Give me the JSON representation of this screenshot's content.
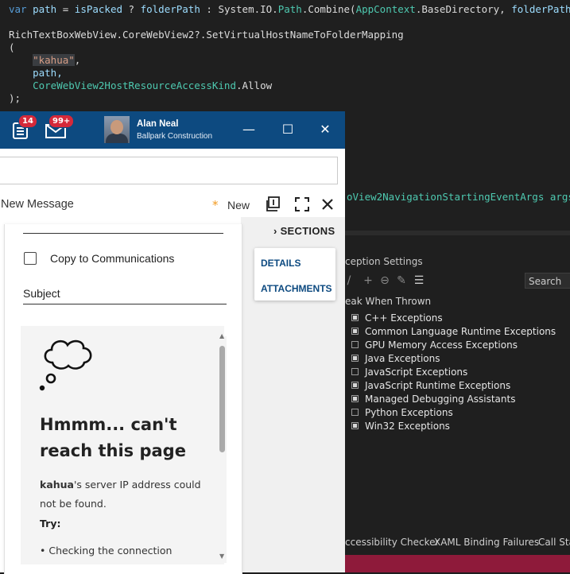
{
  "editor": {
    "line1": {
      "kw": "var",
      "id1": "path",
      "eq": " = ",
      "id2": "isPacked",
      "q": " ? ",
      "id3": "folderPath",
      "c": " : ",
      "ns": "System.IO.",
      "ty": "Path",
      "dot": ".",
      "m": "Combine(",
      "ty2": "AppContext",
      "m2": ".BaseDirectory, ",
      "id4": "folderPath",
      "end": ");"
    },
    "line3": "RichTextBoxWebView.CoreWebView2?.SetVirtualHostNameToFolderMapping",
    "line4": "(",
    "line5_str": "\"kahua\"",
    "line5_end": ",",
    "line6": "path,",
    "line7_ty": "CoreWebView2HostResourceAccessKind",
    "line7_end": ".Allow",
    "line8": ");",
    "fragment": "oView2NavigationStartingEventArgs args)"
  },
  "exceptions": {
    "title": "ception Settings",
    "search": "Search (Ct",
    "header": "eak When Thrown",
    "items": [
      {
        "label": "C++ Exceptions",
        "checked": true
      },
      {
        "label": "Common Language Runtime Exceptions",
        "checked": true
      },
      {
        "label": "GPU Memory Access Exceptions",
        "checked": false
      },
      {
        "label": "Java Exceptions",
        "checked": true
      },
      {
        "label": "JavaScript Exceptions",
        "checked": false
      },
      {
        "label": "JavaScript Runtime Exceptions",
        "checked": true
      },
      {
        "label": "Managed Debugging Assistants",
        "checked": true
      },
      {
        "label": "Python Exceptions",
        "checked": false
      },
      {
        "label": "Win32 Exceptions",
        "checked": true
      }
    ]
  },
  "bottom_tabs": [
    "ccessibility Checker",
    "XAML Binding Failures",
    "Call Sta"
  ],
  "kahua": {
    "badges": {
      "documents": "14",
      "messages": "99+"
    },
    "user": {
      "name": "Alan Neal",
      "company": "Ballpark Construction"
    },
    "window": {
      "minimize": "—",
      "maximize": "☐",
      "close": "✕"
    },
    "message": {
      "title": "New Message",
      "new_label": "New",
      "star": "*"
    },
    "form": {
      "copy_label": "Copy to Communications",
      "subject_label": "Subject"
    },
    "error": {
      "title": "Hmmm... can't reach this page",
      "host": "kahua",
      "msg": "'s server IP address could not be found.",
      "try": "Try:",
      "bullet": "•    Checking the connection"
    },
    "sections": {
      "heading": "SECTIONS",
      "chevron": "›",
      "items": [
        "DETAILS",
        "ATTACHMENTS"
      ]
    }
  },
  "colors": {
    "titlebar": "#0d4a80",
    "badge": "#d5293a",
    "accent": "#f29a1f",
    "statusbar": "#8e1a3a"
  }
}
